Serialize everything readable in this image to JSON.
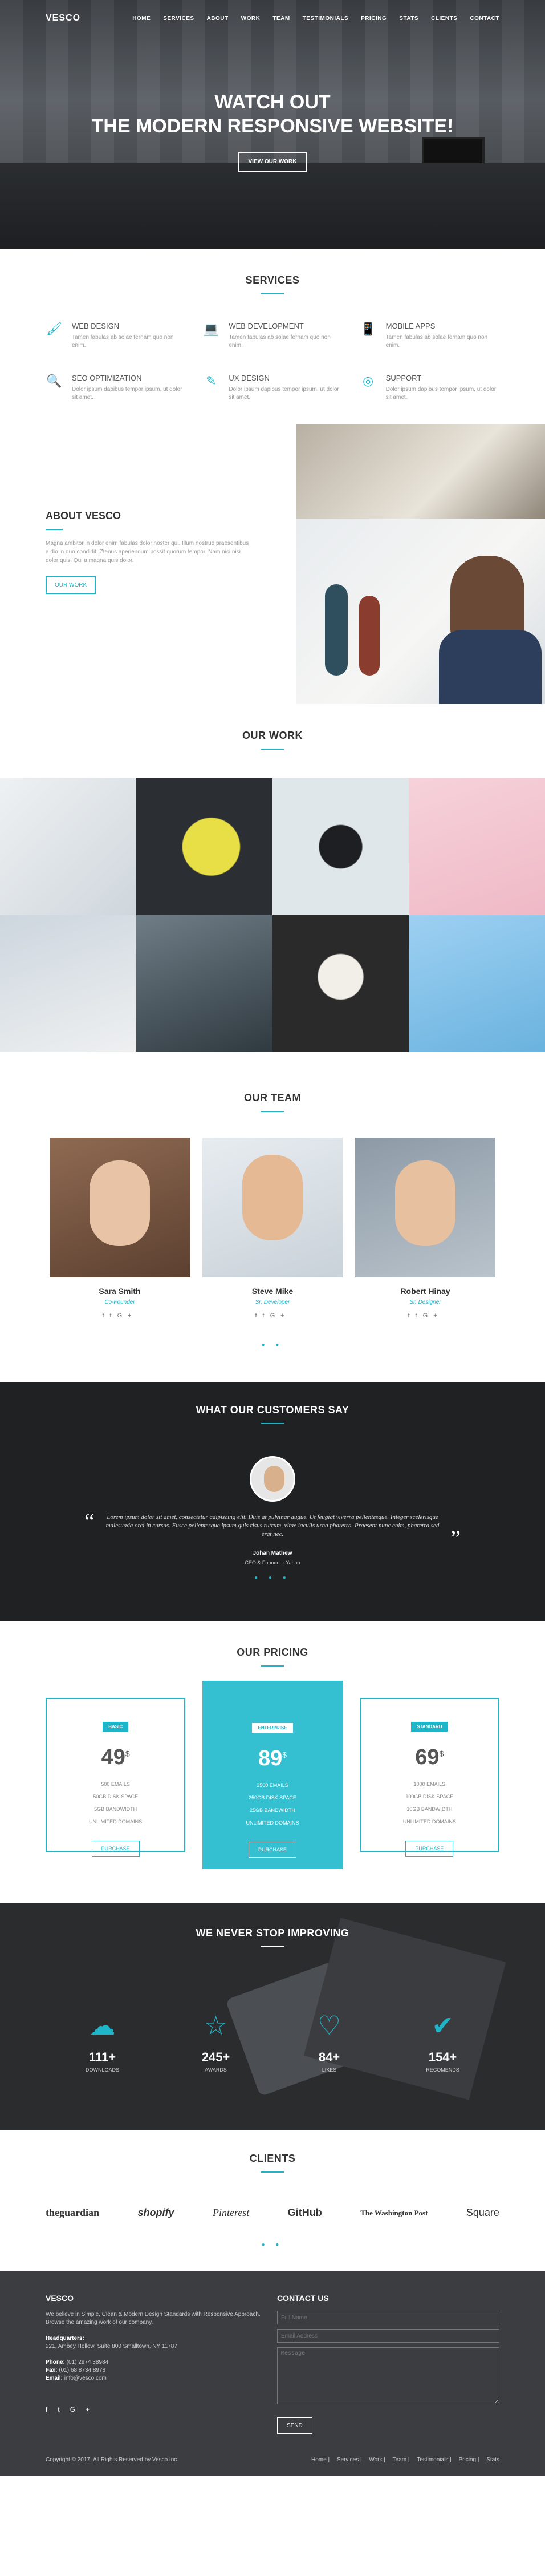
{
  "brand": "VESCO",
  "nav": [
    "HOME",
    "SERVICES",
    "ABOUT",
    "WORK",
    "TEAM",
    "TESTIMONIALS",
    "PRICING",
    "STATS",
    "CLIENTS",
    "CONTACT"
  ],
  "hero": {
    "line1": "WATCH OUT",
    "line2": "THE MODERN RESPONSIVE WEBSITE!",
    "button": "VIEW OUR WORK"
  },
  "services": {
    "title": "SERVICES",
    "items": [
      {
        "icon": "brush-icon",
        "glyph": "🖌",
        "name": "WEB DESIGN",
        "text": "Tamen fabulas ab solae fernam quo non enim."
      },
      {
        "icon": "laptop-icon",
        "glyph": "💻",
        "name": "WEB DEVELOPMENT",
        "text": "Tamen fabulas ab solae fernam quo non enim."
      },
      {
        "icon": "mobile-icon",
        "glyph": "📱",
        "name": "MOBILE APPS",
        "text": "Tamen fabulas ab solae fernam quo non enim."
      },
      {
        "icon": "search-icon",
        "glyph": "🔍",
        "name": "SEO OPTIMIZATION",
        "text": "Dolor ipsum dapibus tempor ipsum, ut dolor sit amet."
      },
      {
        "icon": "edit-icon",
        "glyph": "✎",
        "name": "UX DESIGN",
        "text": "Dolor ipsum dapibus tempor ipsum, ut dolor sit amet."
      },
      {
        "icon": "lifebuoy-icon",
        "glyph": "◎",
        "name": "SUPPORT",
        "text": "Dolor ipsum dapibus tempor ipsum, ut dolor sit amet."
      }
    ]
  },
  "about": {
    "title": "ABOUT VESCO",
    "text": "Magna ambitor in dolor enim fabulas dolor noster qui. Illum nostrud praesentibus a dio in quo condidit. Ztenus aperiendum possit quorum tempor. Nam nisi nisi dolor quis. Qui a magna quis dolor.",
    "button": "OUR WORK"
  },
  "work": {
    "title": "OUR WORK"
  },
  "team": {
    "title": "OUR TEAM",
    "members": [
      {
        "name": "Sara Smith",
        "role": "Co-Founder"
      },
      {
        "name": "Steve Mike",
        "role": "Sr. Developer"
      },
      {
        "name": "Robert Hinay",
        "role": "Sr. Designer"
      }
    ]
  },
  "testimonials": {
    "title": "WHAT OUR CUSTOMERS SAY",
    "quote": "Lorem ipsum dolor sit amet, consectetur adipiscing elit. Duis at pulvinar augue. Ut feugiat viverra pellentesque. Integer scelerisque malesuada orci in cursus. Fusce pellentesque ipsum quis risus rutrum, vitae iaculis urna pharetra. Praesent nunc enim, pharetra sed erat nec.",
    "name": "Johan Mathew",
    "role": "CEO & Founder - Yahoo"
  },
  "pricing": {
    "title": "OUR PRICING",
    "plans": [
      {
        "badge": "BASIC",
        "price": "49",
        "currency": "$",
        "features": [
          "500 EMAILS",
          "50GB DISK SPACE",
          "5GB BANDWIDTH",
          "UNLIMITED DOMAINS"
        ],
        "button": "PURCHASE"
      },
      {
        "badge": "ENTERPRISE",
        "price": "89",
        "currency": "$",
        "features": [
          "2500 EMAILS",
          "250GB DISK SPACE",
          "25GB BANDWIDTH",
          "UNLIMITED DOMAINS"
        ],
        "button": "PURCHASE"
      },
      {
        "badge": "STANDARD",
        "price": "69",
        "currency": "$",
        "features": [
          "1000 EMAILS",
          "100GB DISK SPACE",
          "10GB BANDWIDTH",
          "UNLIMITED DOMAINS"
        ],
        "button": "PURCHASE"
      }
    ]
  },
  "stats": {
    "title": "WE NEVER STOP IMPROVING",
    "items": [
      {
        "icon": "cloud-download-icon",
        "glyph": "☁",
        "value": "111+",
        "label": "DOWNLOADS"
      },
      {
        "icon": "star-icon",
        "glyph": "☆",
        "value": "245+",
        "label": "AWARDS"
      },
      {
        "icon": "heart-icon",
        "glyph": "♡",
        "value": "84+",
        "label": "LIKES"
      },
      {
        "icon": "check-icon",
        "glyph": "✔",
        "value": "154+",
        "label": "RECOMENDS"
      }
    ]
  },
  "clients": {
    "title": "CLIENTS",
    "logos": [
      "theguardian",
      "shopify",
      "Pinterest",
      "GitHub",
      "The Washington Post",
      "Square"
    ]
  },
  "footer": {
    "brand": "VESCO",
    "intro": "We believe in Simple, Clean & Modern Design Standards with Responsive Approach. Browse the amazing work of our company.",
    "hq_label": "Headquarters:",
    "address": "221, Ambey Hollow, Suite 800 Smalltown, NY 11787",
    "phone_label": "Phone:",
    "phone": "(01) 2974 38984",
    "fax_label": "Fax:",
    "fax": "(01) 68 8734 8978",
    "email_label": "Email:",
    "email": "info@vesco.com",
    "contact_title": "CONTACT US",
    "name_placeholder": "Full Name",
    "email_placeholder": "Email Address",
    "message_placeholder": "Message",
    "send": "SEND",
    "copyright": "Copyright © 2017. All Rights Reserved by Vesco Inc.",
    "links": [
      "Home",
      "Services",
      "Work",
      "Team",
      "Testimonials",
      "Pricing",
      "Stats"
    ]
  },
  "colors": {
    "accent": "#1fb5c9",
    "dark": "#1f2123",
    "footer": "#3b3d40"
  }
}
